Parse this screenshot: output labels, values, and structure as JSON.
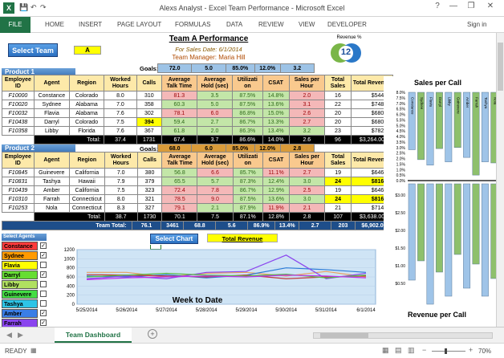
{
  "window": {
    "title": "Alexs Analyst - Excel Team Performance - Microsoft Excel",
    "help": "?",
    "minimize": "—",
    "restore": "❐",
    "close": "✕",
    "icon": "X"
  },
  "ribbon": {
    "file": "FILE",
    "tabs": [
      "HOME",
      "INSERT",
      "PAGE LAYOUT",
      "FORMULAS",
      "DATA",
      "REVIEW",
      "VIEW",
      "DEVELOPER"
    ],
    "signin": "Sign in"
  },
  "header": {
    "title": "Team A Performance",
    "sales_date": "For Sales Date: 6/1/2014",
    "manager": "Team Manager: Maria Hill",
    "select_team": "Select Team",
    "team_value": "A",
    "revenue_label": "Revenue %",
    "gauge_value": "12"
  },
  "goals_label": "Goals:",
  "product1": {
    "label": "Product 1",
    "goals": [
      "72.0",
      "5.0",
      "85.0%",
      "12.0%",
      "3.2"
    ],
    "columns": [
      "Employee ID",
      "Agent",
      "Region",
      "Worked Hours",
      "Calls",
      "Average Talk Time",
      "Average Hold (sec)",
      "Utilizati on",
      "CSAT",
      "Sales per Hour",
      "Total Sales",
      "Total Revenue"
    ],
    "rows": [
      [
        "F10000",
        "Constance",
        "Colorado",
        "8.0",
        "310",
        "81.3",
        "3.5",
        "87.5%",
        "14.8%",
        "2.0",
        "16",
        "$544.00"
      ],
      [
        "F10020",
        "Sydnee",
        "Alabama",
        "7.0",
        "358",
        "60.3",
        "5.0",
        "87.5%",
        "13.6%",
        "3.1",
        "22",
        "$748.00"
      ],
      [
        "F10032",
        "Flavia",
        "Alabama",
        "7.6",
        "302",
        "78.1",
        "6.0",
        "86.8%",
        "15.0%",
        "2.6",
        "20",
        "$680.00"
      ],
      [
        "F10438",
        "Darryl",
        "Colorado",
        "7.5",
        "394",
        "59.4",
        "2.7",
        "86.7%",
        "13.3%",
        "2.7",
        "20",
        "$680.00"
      ],
      [
        "F10358",
        "Libby",
        "Florida",
        "7.6",
        "367",
        "61.8",
        "2.0",
        "86.3%",
        "13.4%",
        "3.2",
        "23",
        "$782.00"
      ]
    ],
    "total": [
      "Total:",
      "37.4",
      "1731",
      "67.4",
      "3.7",
      "86.6%",
      "14.0%",
      "2.6",
      "96",
      "$3,264.00"
    ]
  },
  "product2": {
    "label": "Product 2",
    "goals": [
      "68.0",
      "6.0",
      "85.0%",
      "12.0%",
      "2.8"
    ],
    "columns": [
      "Employee ID",
      "Agent",
      "Region",
      "Worked Hours",
      "Calls",
      "Average Talk Time",
      "Average Hold (sec)",
      "Utilizati on",
      "CSAT",
      "Sales per Hour",
      "Total Sales",
      "Total Revenue"
    ],
    "rows": [
      [
        "F10845",
        "Guinevere",
        "California",
        "7.0",
        "380",
        "56.8",
        "6.6",
        "85.7%",
        "11.1%",
        "2.7",
        "19",
        "$646.00"
      ],
      [
        "F10831",
        "Tashya",
        "Hawaii",
        "7.9",
        "379",
        "65.5",
        "5.7",
        "87.3%",
        "12.4%",
        "3.0",
        "24",
        "$816.00"
      ],
      [
        "F10439",
        "Amber",
        "California",
        "7.5",
        "323",
        "72.4",
        "7.8",
        "86.7%",
        "12.9%",
        "2.5",
        "19",
        "$646.00"
      ],
      [
        "F10310",
        "Farrah",
        "Connecticut",
        "8.0",
        "321",
        "78.5",
        "9.0",
        "87.5%",
        "13.6%",
        "3.0",
        "24",
        "$816.00"
      ],
      [
        "F10253",
        "Nola",
        "Connecticut",
        "8.3",
        "327",
        "79.1",
        "2.1",
        "87.9%",
        "11.9%",
        "2.1",
        "21",
        "$714.00"
      ]
    ],
    "total": [
      "Total:",
      "38.7",
      "1730",
      "70.1",
      "7.5",
      "87.1%",
      "12.8%",
      "2.8",
      "107",
      "$3,638.00"
    ]
  },
  "team_total": [
    "Team Total:",
    "76.1",
    "3461",
    "68.8",
    "5.6",
    "86.9%",
    "13.4%",
    "2.7",
    "203",
    "$6,902.00"
  ],
  "select_agents": {
    "label": "Select Agents",
    "agents": [
      {
        "name": "Constance",
        "color": "#ff3b3b",
        "checked": true
      },
      {
        "name": "Sydnee",
        "color": "#ff9a00",
        "checked": true
      },
      {
        "name": "Flavia",
        "color": "#ffff00",
        "checked": false
      },
      {
        "name": "Darryl",
        "color": "#66dd33",
        "checked": true
      },
      {
        "name": "Libby",
        "color": "#b0e060",
        "checked": false
      },
      {
        "name": "Guinevere",
        "color": "#44dd44",
        "checked": false
      },
      {
        "name": "Tashya",
        "color": "#2ec4e6",
        "checked": false
      },
      {
        "name": "Amber",
        "color": "#3a7ee6",
        "checked": true
      },
      {
        "name": "Farrah",
        "color": "#8a44ee",
        "checked": true
      },
      {
        "name": "Nola",
        "color": "#c030ee",
        "checked": true
      }
    ]
  },
  "select_chart": {
    "label": "Select Chart",
    "value": "Total Revenue"
  },
  "line_chart": {
    "title": "Week to Date"
  },
  "right_chart": {
    "title_top": "Sales per Call",
    "title_bottom": "Revenue per Call",
    "top_ticks": [
      "8.0%",
      "7.5%",
      "7.0%",
      "6.5%",
      "6.0%",
      "5.5%",
      "5.0%",
      "4.5%",
      "4.0%",
      "3.5%",
      "3.0%",
      "2.5%",
      "2.0%",
      "1.5%",
      "1.0%",
      "0.5%",
      "0.0%"
    ],
    "bottom_ticks": [
      "$3.00",
      "$2.50",
      "$2.00",
      "$1.50",
      "$1.00",
      "$0.50"
    ]
  },
  "chart_data": [
    {
      "type": "line",
      "title": "Week to Date",
      "xlabel": "",
      "ylabel": "",
      "ylim": [
        0,
        1200
      ],
      "yticks": [
        "1200",
        "1000",
        "800",
        "600",
        "400",
        "200",
        "0"
      ],
      "categories": [
        "5/25/2014",
        "5/26/2014",
        "5/27/2014",
        "5/28/2014",
        "5/29/2014",
        "5/30/2014",
        "5/31/2014",
        "6/1/2014"
      ],
      "series": [
        {
          "color": "#e8a060",
          "values": [
            700,
            700,
            600,
            680,
            700,
            620,
            720,
            600
          ]
        },
        {
          "color": "#2a7ad6",
          "values": [
            620,
            600,
            650,
            580,
            640,
            800,
            760,
            700
          ]
        },
        {
          "color": "#8a44ee",
          "values": [
            560,
            620,
            560,
            700,
            720,
            1080,
            560,
            680
          ]
        },
        {
          "color": "#c03a3a",
          "values": [
            650,
            640,
            620,
            600,
            640,
            560,
            600,
            620
          ]
        },
        {
          "color": "#55bb44",
          "values": [
            600,
            640,
            680,
            640,
            620,
            660,
            580,
            640
          ]
        },
        {
          "color": "#c030ee",
          "values": [
            540,
            580,
            600,
            620,
            600,
            640,
            620,
            580
          ]
        }
      ]
    },
    {
      "type": "bar",
      "title": "Sales per Call",
      "ylim": [
        0,
        0.08
      ],
      "categories": [
        "Constance",
        "Sydnee",
        "Flavia",
        "Darryl",
        "Libby",
        "Guinevere",
        "Amber",
        "Farrah",
        "Tashya",
        "Nola"
      ],
      "values": [
        0.052,
        0.061,
        0.066,
        0.051,
        0.063,
        0.05,
        0.059,
        0.075,
        0.063,
        0.064
      ]
    }
  ],
  "sheet_tab": "Team Dashboard",
  "status": {
    "ready": "READY",
    "zoom": "70%"
  }
}
